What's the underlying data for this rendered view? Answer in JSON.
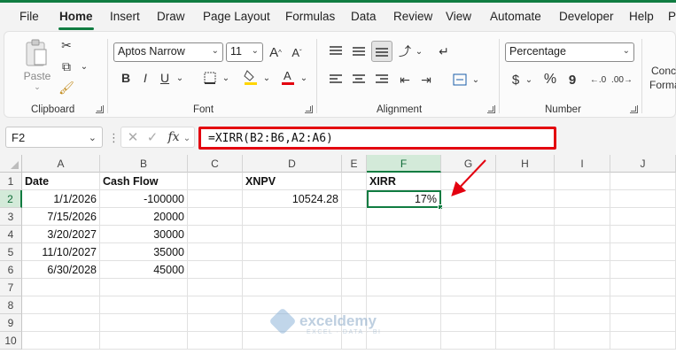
{
  "menu": {
    "tabs": [
      "File",
      "Home",
      "Insert",
      "Draw",
      "Page Layout",
      "Formulas",
      "Data",
      "Review",
      "View",
      "Automate",
      "Developer",
      "Help",
      "P"
    ],
    "active": "Home"
  },
  "ribbon": {
    "clipboard": {
      "label": "Clipboard",
      "paste_label": "Paste"
    },
    "font": {
      "label": "Font",
      "font_name": "Aptos Narrow",
      "font_size": "11",
      "bold": "B",
      "italic": "I",
      "underline": "U",
      "grow": "A^",
      "shrink": "Aˇ"
    },
    "alignment": {
      "label": "Alignment"
    },
    "number": {
      "label": "Number",
      "format": "Percentage",
      "currency": "$",
      "percent": "%",
      "comma": "9"
    },
    "styles": {
      "cond_line1": "Conc",
      "cond_line2": "Forma"
    }
  },
  "formula_bar": {
    "name_box": "F2",
    "fx": "fx",
    "formula": "=XIRR(B2:B6,A2:A6)"
  },
  "grid": {
    "columns": [
      "A",
      "B",
      "C",
      "D",
      "E",
      "F",
      "G",
      "H",
      "I",
      "J"
    ],
    "rows": [
      "1",
      "2",
      "3",
      "4",
      "5",
      "6",
      "7",
      "8",
      "9",
      "10"
    ],
    "selected_col": "F",
    "selected_row": "2",
    "headers": {
      "date": "Date",
      "cash_flow": "Cash Flow",
      "xnpv": "XNPV",
      "xirr": "XIRR"
    },
    "dates": [
      "1/1/2026",
      "7/15/2026",
      "3/20/2027",
      "11/10/2027",
      "6/30/2028"
    ],
    "cash_flows": [
      "-100000",
      "20000",
      "30000",
      "35000",
      "45000"
    ],
    "xnpv_value": "10524.28",
    "xirr_value": "17%"
  },
  "watermark": {
    "name": "exceldemy",
    "tagline": "EXCEL · DATA · BI"
  },
  "colors": {
    "accent": "#107c41",
    "highlight": "#e3000f"
  }
}
